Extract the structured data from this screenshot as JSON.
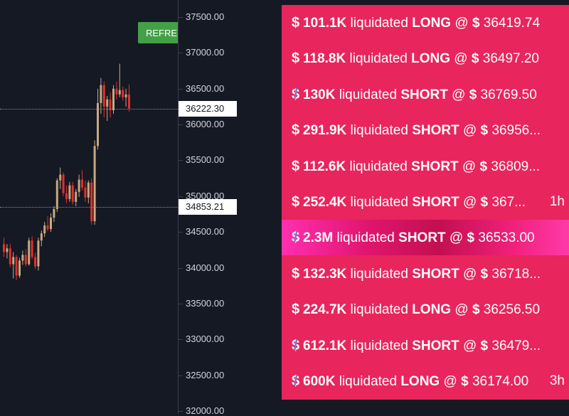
{
  "refresh_button": {
    "label": "REFRESH"
  },
  "price_axis": {
    "ticks": [
      "37500.00",
      "37000.00",
      "36500.00",
      "36000.00",
      "35500.00",
      "35000.00",
      "34500.00",
      "34000.00",
      "33500.00",
      "33000.00",
      "32500.00",
      "32000.00"
    ],
    "current_price": "36222.30",
    "marked_price": "34853.21"
  },
  "candles": [
    {
      "o": 34330,
      "h": 34420,
      "l": 34150,
      "c": 34220
    },
    {
      "o": 34220,
      "h": 34330,
      "l": 34130,
      "c": 34270
    },
    {
      "o": 34270,
      "h": 34330,
      "l": 34010,
      "c": 34050
    },
    {
      "o": 34050,
      "h": 34220,
      "l": 33850,
      "c": 34150
    },
    {
      "o": 34150,
      "h": 34180,
      "l": 33830,
      "c": 33890
    },
    {
      "o": 33890,
      "h": 34140,
      "l": 33860,
      "c": 34100
    },
    {
      "o": 34100,
      "h": 34240,
      "l": 34040,
      "c": 34180
    },
    {
      "o": 34180,
      "h": 34260,
      "l": 34020,
      "c": 34050
    },
    {
      "o": 34050,
      "h": 34420,
      "l": 34030,
      "c": 34380
    },
    {
      "o": 34380,
      "h": 34440,
      "l": 34120,
      "c": 34150
    },
    {
      "o": 34150,
      "h": 34210,
      "l": 33980,
      "c": 34020
    },
    {
      "o": 34020,
      "h": 34420,
      "l": 33960,
      "c": 34380
    },
    {
      "o": 34380,
      "h": 34520,
      "l": 34300,
      "c": 34480
    },
    {
      "o": 34480,
      "h": 34640,
      "l": 34430,
      "c": 34590
    },
    {
      "o": 34590,
      "h": 34720,
      "l": 34510,
      "c": 34540
    },
    {
      "o": 34540,
      "h": 34760,
      "l": 34500,
      "c": 34700
    },
    {
      "o": 34700,
      "h": 34860,
      "l": 34640,
      "c": 34820
    },
    {
      "o": 34820,
      "h": 35250,
      "l": 34780,
      "c": 35220
    },
    {
      "o": 35220,
      "h": 35400,
      "l": 35100,
      "c": 35300
    },
    {
      "o": 35300,
      "h": 35330,
      "l": 35000,
      "c": 35040
    },
    {
      "o": 35040,
      "h": 35150,
      "l": 34900,
      "c": 34960
    },
    {
      "o": 34960,
      "h": 35200,
      "l": 34920,
      "c": 35150
    },
    {
      "o": 35150,
      "h": 35200,
      "l": 34880,
      "c": 34920
    },
    {
      "o": 34920,
      "h": 35100,
      "l": 34860,
      "c": 35060
    },
    {
      "o": 35060,
      "h": 35300,
      "l": 34990,
      "c": 35230
    },
    {
      "o": 35230,
      "h": 35360,
      "l": 35080,
      "c": 35120
    },
    {
      "o": 35120,
      "h": 35220,
      "l": 34920,
      "c": 34980
    },
    {
      "o": 34980,
      "h": 35220,
      "l": 34900,
      "c": 35190
    },
    {
      "o": 35190,
      "h": 35250,
      "l": 34600,
      "c": 34650
    },
    {
      "o": 34650,
      "h": 35780,
      "l": 34600,
      "c": 35700
    },
    {
      "o": 35700,
      "h": 36500,
      "l": 35650,
      "c": 36300
    },
    {
      "o": 36300,
      "h": 36650,
      "l": 36150,
      "c": 36550
    },
    {
      "o": 36550,
      "h": 36600,
      "l": 36100,
      "c": 36250
    },
    {
      "o": 36250,
      "h": 36400,
      "l": 36050,
      "c": 36350
    },
    {
      "o": 36350,
      "h": 36450,
      "l": 36100,
      "c": 36200
    },
    {
      "o": 36200,
      "h": 36550,
      "l": 36150,
      "c": 36500
    },
    {
      "o": 36500,
      "h": 36600,
      "l": 36350,
      "c": 36420
    },
    {
      "o": 36420,
      "h": 36850,
      "l": 36380,
      "c": 36480
    },
    {
      "o": 36480,
      "h": 36530,
      "l": 36330,
      "c": 36380
    },
    {
      "o": 36380,
      "h": 36500,
      "l": 36250,
      "c": 36420
    },
    {
      "o": 36420,
      "h": 36560,
      "l": 36180,
      "c": 36222
    }
  ],
  "colors": {
    "up": "#c8a97e",
    "down": "#e0302f",
    "panel": "#e8255c",
    "button": "#43a047"
  },
  "liquidations": [
    {
      "amount": "101.1K",
      "text": " liquidated ",
      "side": "LONG",
      "at": " @ ",
      "price": "36419.74",
      "time": "",
      "icon": "bitcoin-coin",
      "whale": false
    },
    {
      "amount": "118.8K",
      "text": " liquidated ",
      "side": "LONG",
      "at": " @ ",
      "price": "36497.20",
      "time": "",
      "icon": "bitcoin-coin",
      "whale": false
    },
    {
      "amount": "130K",
      "text": " liquidated ",
      "side": "SHORT",
      "at": " @ ",
      "price": "36769.50",
      "time": "",
      "icon": "ethereum-coin",
      "whale": false
    },
    {
      "amount": "291.9K",
      "text": " liquidated ",
      "side": "SHORT",
      "at": " @ ",
      "price": "36956...",
      "time": "",
      "icon": "bitcoin-coin",
      "whale": false
    },
    {
      "amount": "112.6K",
      "text": " liquidated ",
      "side": "SHORT",
      "at": " @ ",
      "price": "36809...",
      "time": "",
      "icon": "bitcoin-coin",
      "whale": false
    },
    {
      "amount": "252.4K",
      "text": " liquidated ",
      "side": "SHORT",
      "at": " @ ",
      "price": "367...",
      "time": "1h",
      "icon": "bitcoin-coin",
      "whale": false
    },
    {
      "amount": "2.3M",
      "text": " liquidated ",
      "side": "SHORT",
      "at": " @ ",
      "price": "36533.00",
      "time": "",
      "icon": "ethereum-coin",
      "whale": true
    },
    {
      "amount": "132.3K",
      "text": " liquidated ",
      "side": "SHORT",
      "at": " @ ",
      "price": "36718...",
      "time": "",
      "icon": "bitcoin-coin",
      "whale": false
    },
    {
      "amount": "224.7K",
      "text": " liquidated ",
      "side": "LONG",
      "at": " @ ",
      "price": "36256.50",
      "time": "",
      "icon": "bitcoin-coin",
      "whale": false
    },
    {
      "amount": "612.1K",
      "text": " liquidated ",
      "side": "SHORT",
      "at": " @ ",
      "price": "36479...",
      "time": "",
      "icon": "ethereum-coin",
      "whale": false
    },
    {
      "amount": "600K",
      "text": " liquidated ",
      "side": "LONG",
      "at": " @ ",
      "price": "36174.00",
      "time": "3h",
      "icon": "ethereum-coin",
      "whale": false
    }
  ]
}
